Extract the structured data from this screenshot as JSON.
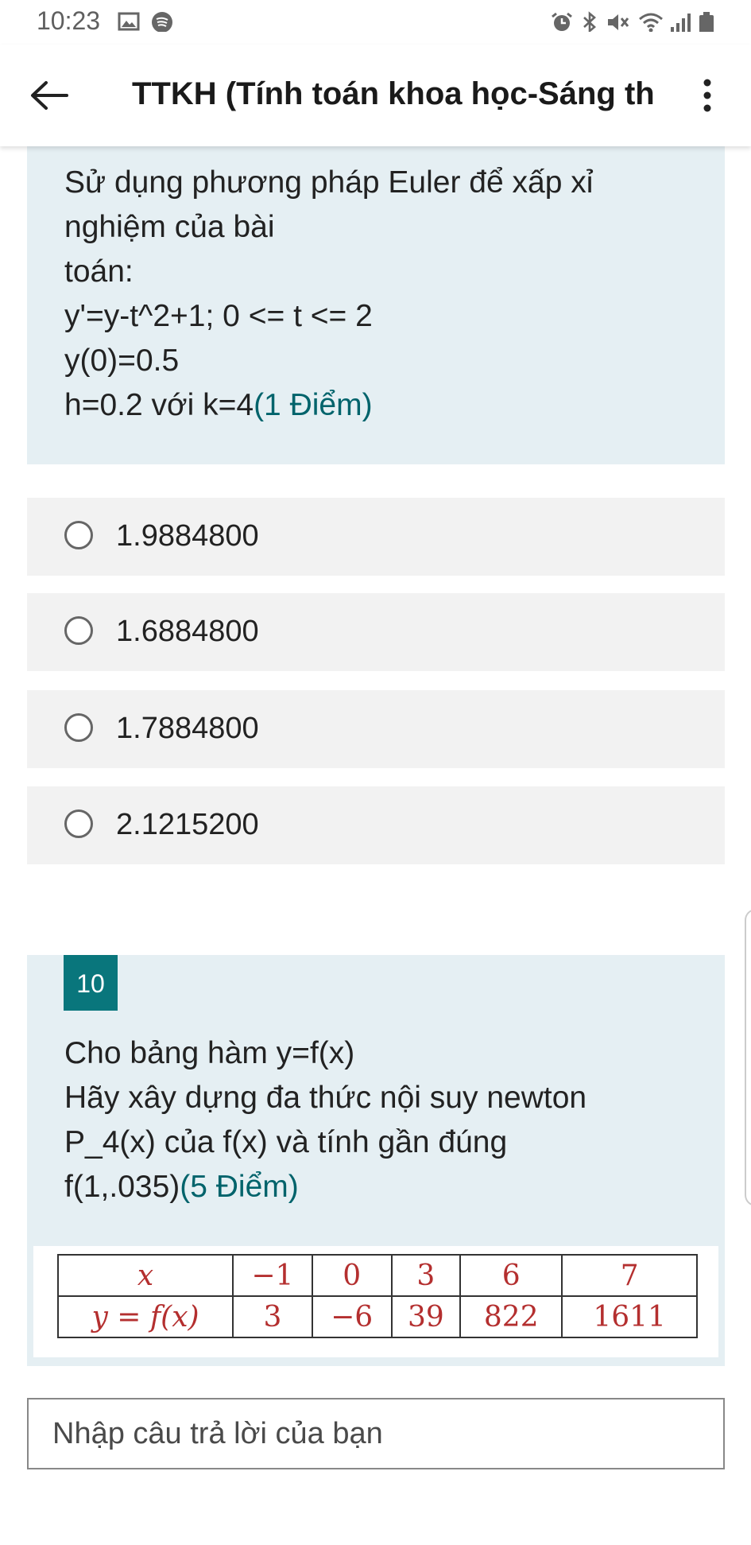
{
  "status_bar": {
    "time": "10:23",
    "left_icons": [
      "image-icon",
      "spotify-icon"
    ],
    "right_icons": [
      "alarm-icon",
      "bluetooth-icon",
      "mute-icon",
      "wifi-icon",
      "signal-icon",
      "battery-icon"
    ]
  },
  "app_bar": {
    "title": "TTKH (Tính toán khoa học-Sáng th...",
    "back_icon": "arrow-left-icon",
    "menu_icon": "more-vert-icon"
  },
  "question9": {
    "lines": [
      "Sử dụng phương pháp Euler để xấp xỉ",
      "nghiệm của bài",
      "toán:",
      "y'=y-t^2+1; 0 <= t <= 2",
      "y(0)=0.5",
      "h=0.2 với k=4"
    ],
    "points": "(1 Điểm)",
    "options": [
      "1.9884800",
      "1.6884800",
      "1.7884800",
      "2.1215200"
    ]
  },
  "question10": {
    "number": "10",
    "lines": [
      "Cho bảng hàm y=f(x)",
      "Hãy xây dựng đa thức nội suy newton",
      "P_4(x) của f(x) và tính gần đúng",
      "f(1,.035)"
    ],
    "points": "(5 Điểm)",
    "table": {
      "x_label": "x",
      "y_label": "y = f(x)",
      "x_values": [
        "−1",
        "0",
        "3",
        "6",
        "7"
      ],
      "y_values": [
        "3",
        "−6",
        "39",
        "822",
        "1611"
      ]
    },
    "answer_placeholder": "Nhập câu trả lời của bạn"
  },
  "colors": {
    "panel_bg": "#e5eff3",
    "option_bg": "#f2f2f2",
    "accent_teal": "#09767c",
    "points_text": "#00636b",
    "table_text": "#b42f2f"
  }
}
